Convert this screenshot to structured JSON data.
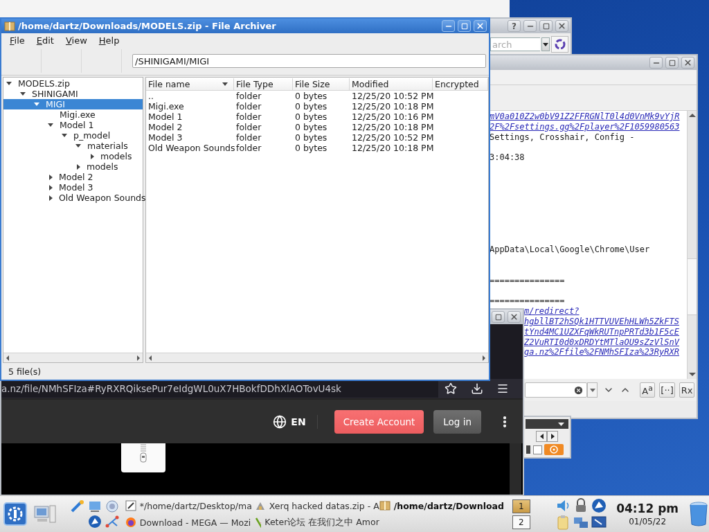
{
  "search_window": {
    "help": "?",
    "placeholder": "arch"
  },
  "viewer": {
    "lines": [
      {
        "kind": "link",
        "text": "mV0a010Z2w0bV91Z2FFRGNlT0l4d0VnMk9vYjR"
      },
      {
        "kind": "link",
        "text": "2F%2Fsettings.gg%2Fplayer%2F1059980563"
      },
      {
        "kind": "plain",
        "text": "Settings, Crosshair, Config -"
      },
      {
        "kind": "blank"
      },
      {
        "kind": "plain",
        "text": "3:04:38"
      },
      {
        "kind": "blank"
      },
      {
        "kind": "blank"
      },
      {
        "kind": "blank"
      },
      {
        "kind": "blank"
      },
      {
        "kind": "blank"
      },
      {
        "kind": "blank"
      },
      {
        "kind": "blank"
      },
      {
        "kind": "blank"
      },
      {
        "kind": "plain",
        "text": "AppData\\Local\\Google\\Chrome\\User"
      },
      {
        "kind": "blank"
      },
      {
        "kind": "blank"
      },
      {
        "kind": "plain",
        "text": "==============="
      },
      {
        "kind": "blank"
      },
      {
        "kind": "plain",
        "text": "==============="
      },
      {
        "kind": "link-cut",
        "text": "m/redirect?"
      },
      {
        "kind": "link-cut",
        "text": "hgbllBT2hSQk1HTTVUVEhHLWh5ZkFTS"
      },
      {
        "kind": "link-cut",
        "text": "tYnd4MC1UZXFqWkRUTnpPRTd3b1F5cE"
      },
      {
        "kind": "link-cut",
        "text": "Z2VuRTI0d0xDRDYtMTlaOU9sZzVlSnV"
      },
      {
        "kind": "link-cut",
        "text": "ga.nz%2Ffile%2FNMhSFIza%23RyRXR"
      }
    ],
    "find_buttons": [
      "A$^{a}$",
      "[··]",
      "Rx"
    ]
  },
  "panel": {
    "checked": false
  },
  "browser": {
    "url": "a.nz/file/NMhSFIza#RyRXRQiksePur7eIdgWL0uX7HBokfDDhXlAOTovU4sk",
    "language": "EN",
    "create_account": "Create Account",
    "log_in": "Log in"
  },
  "archiver": {
    "title": "/home/dartz/Downloads/MODELS.zip - File Archiver",
    "menu": [
      "File",
      "Edit",
      "View",
      "Help"
    ],
    "location": "/SHINIGAMI/MIGI",
    "tree": [
      {
        "label": "MODELS.zip",
        "expanded": true,
        "selected": false,
        "children": [
          {
            "label": "SHINIGAMI",
            "expanded": true,
            "selected": false,
            "children": [
              {
                "label": "MIGI",
                "expanded": true,
                "selected": true,
                "children": [
                  {
                    "label": "Migi.exe",
                    "selected": false
                  },
                  {
                    "label": "Model 1",
                    "expanded": true,
                    "selected": false,
                    "children": [
                      {
                        "label": "p_model",
                        "expanded": true,
                        "selected": false,
                        "children": [
                          {
                            "label": "materials",
                            "expanded": true,
                            "selected": false,
                            "children": [
                              {
                                "label": "models",
                                "expanded": false,
                                "selected": false
                              }
                            ]
                          },
                          {
                            "label": "models",
                            "expanded": false,
                            "selected": false
                          }
                        ]
                      }
                    ]
                  },
                  {
                    "label": "Model 2",
                    "expanded": false,
                    "selected": false
                  },
                  {
                    "label": "Model 3",
                    "expanded": false,
                    "selected": false
                  },
                  {
                    "label": "Old Weapon Sounds",
                    "expanded": false,
                    "selected": false
                  }
                ]
              }
            ]
          }
        ]
      }
    ],
    "columns": [
      {
        "label": "File name",
        "sorted": true
      },
      {
        "label": "File Type",
        "sorted": false
      },
      {
        "label": "File Size",
        "sorted": false
      },
      {
        "label": "Modified",
        "sorted": false
      },
      {
        "label": "Encrypted",
        "sorted": false
      }
    ],
    "rows": [
      [
        "..",
        "folder",
        "0 bytes",
        "12/25/20 10:52 PM"
      ],
      [
        "Migi.exe",
        "folder",
        "0 bytes",
        "12/25/20 10:18 PM"
      ],
      [
        "Model 1",
        "folder",
        "0 bytes",
        "12/25/20 10:16 PM"
      ],
      [
        "Model 2",
        "folder",
        "0 bytes",
        "12/25/20 10:18 PM"
      ],
      [
        "Model 3",
        "folder",
        "0 bytes",
        "12/25/20 10:52 PM"
      ],
      [
        "Old Weapon Sounds",
        "folder",
        "0 bytes",
        "12/25/20 10:18 PM"
      ]
    ],
    "status": "5 file(s)"
  },
  "taskbar": {
    "tasks": [
      {
        "title": "*/home/dartz/Desktop/ma",
        "kind": "editor",
        "active": false
      },
      {
        "title": "Xerq hacked datas.zip - A",
        "kind": "archive",
        "active": false
      },
      {
        "title": "/home/dartz/Download",
        "kind": "package",
        "active": true
      },
      {
        "title": "Download - MEGA — Mozi",
        "kind": "browser",
        "active": false
      },
      {
        "title": "Keter论坛 在我们之中 Amor",
        "kind": "chat",
        "active": false
      }
    ],
    "pager": [
      {
        "label": "1",
        "selected": true
      },
      {
        "label": "2",
        "selected": false
      }
    ],
    "time": "04:12 pm",
    "date": "01/05/22"
  }
}
